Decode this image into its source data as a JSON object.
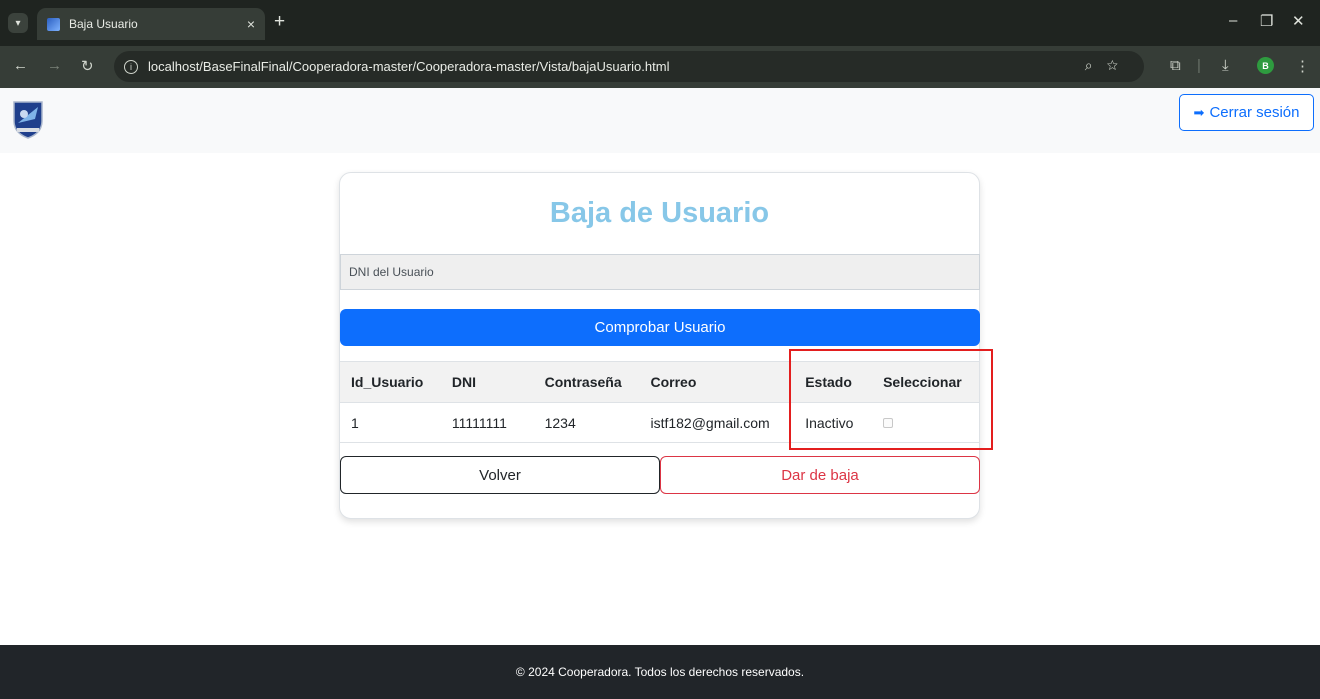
{
  "browser": {
    "tab_title": "Baja Usuario",
    "tab_close": "×",
    "new_tab": "+",
    "url": "localhost/BaseFinalFinal/Cooperadora-master/Cooperadora-master/Vista/bajaUsuario.html",
    "profile_initial": "B"
  },
  "header": {
    "logout_label": "Cerrar sesión"
  },
  "card": {
    "title": "Baja de Usuario",
    "dni_placeholder": "DNI del Usuario",
    "check_button": "Comprobar Usuario",
    "back_button": "Volver",
    "delete_button": "Dar de baja"
  },
  "table": {
    "headers": [
      "Id_Usuario",
      "DNI",
      "Contraseña",
      "Correo",
      "Estado",
      "Seleccionar"
    ],
    "rows": [
      {
        "id": "1",
        "dni": "11111111",
        "password": "1234",
        "email": "istf182@gmail.com",
        "estado": "Inactivo",
        "selected": false
      }
    ]
  },
  "footer": {
    "text": "© 2024 Cooperadora. Todos los derechos reservados."
  },
  "colors": {
    "primary": "#0d6efd",
    "danger": "#dc3545",
    "title": "#87c7e8",
    "highlight": "#e31e1e"
  }
}
